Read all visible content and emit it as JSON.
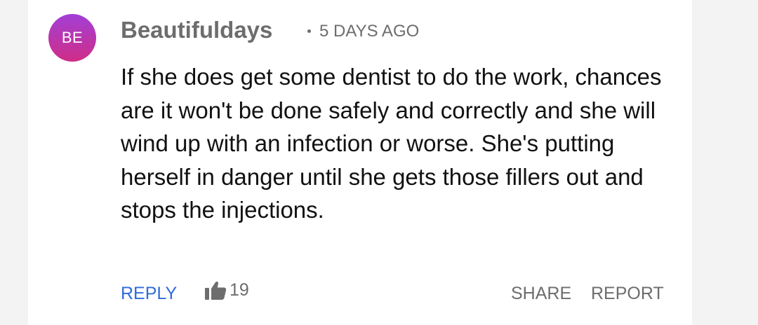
{
  "comment": {
    "avatar_initials": "BE",
    "username": "Beautifuldays",
    "separator": "·",
    "timestamp": "5 DAYS AGO",
    "body": "If she does get some dentist to do the work, chances are it won't be done safely and correctly and she will wind up with an infection or worse. She's putting herself in danger until she gets those fillers out and stops the injections.",
    "actions": {
      "reply_label": "REPLY",
      "like_icon": "thumbs-up-icon",
      "like_count": "19",
      "share_label": "SHARE",
      "report_label": "REPORT"
    }
  },
  "colors": {
    "page_background": "#f3f3f3",
    "card_background": "#ffffff",
    "avatar_gradient_top": "#a23fd6",
    "avatar_gradient_bottom": "#d02d86",
    "accent_link": "#2f6bdc",
    "muted_text": "#6d6d6d",
    "body_text": "#111111"
  }
}
